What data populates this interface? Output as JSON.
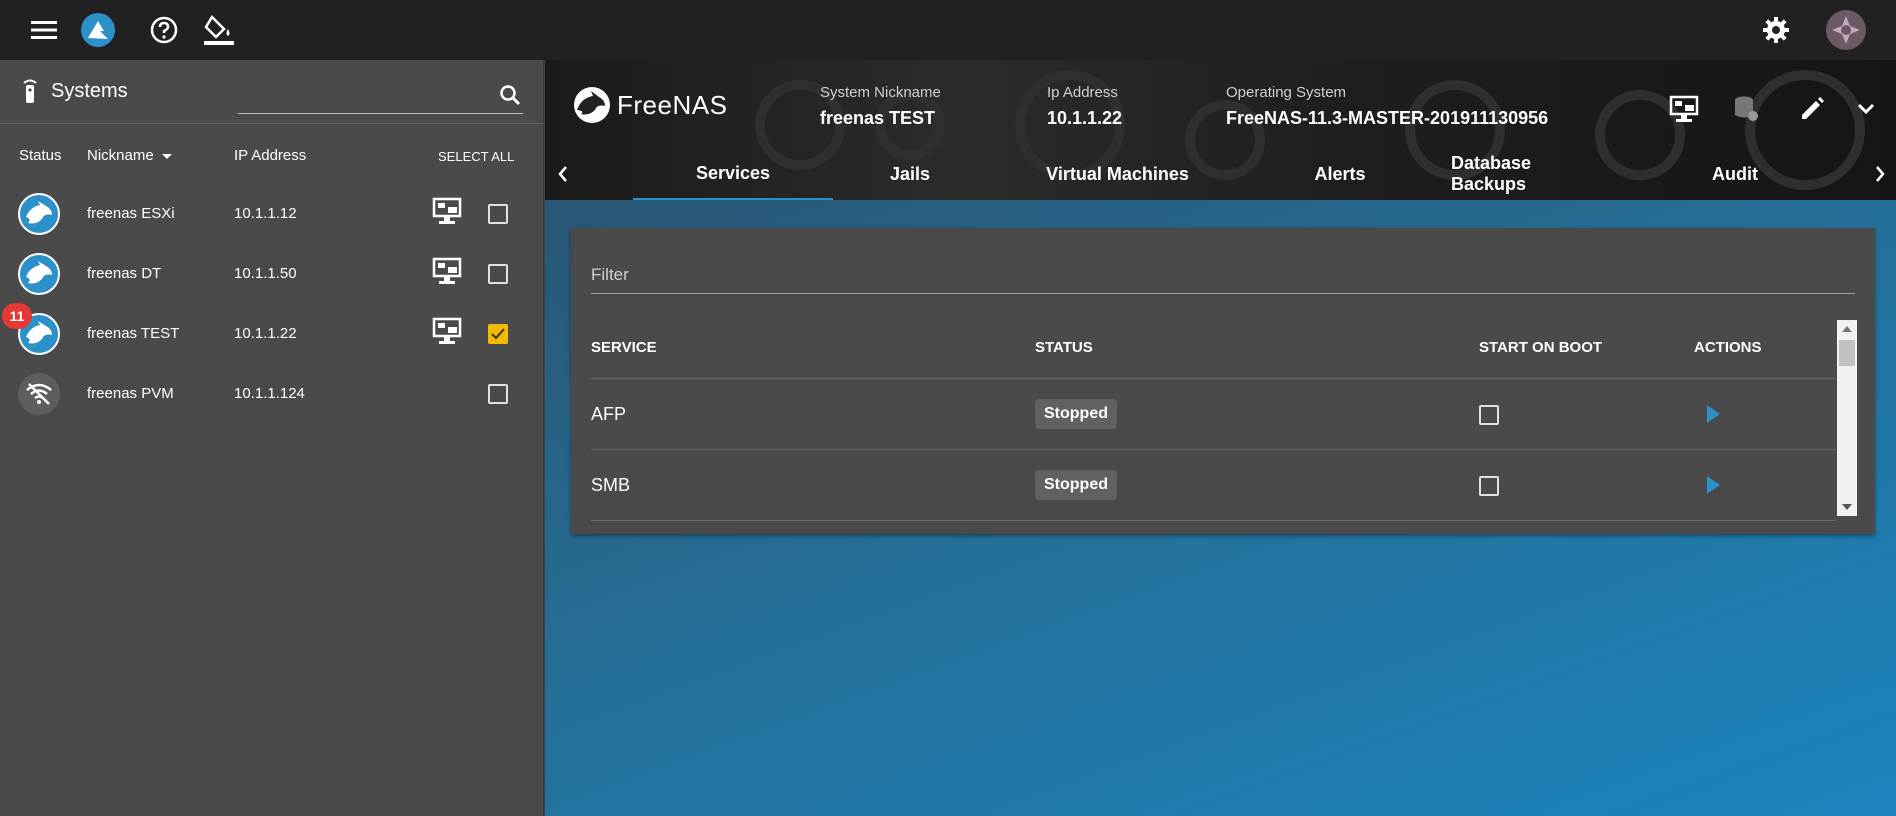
{
  "topbar": {
    "icons": [
      "menu-icon",
      "truecommand-logo-icon",
      "help-icon",
      "theme-paint-icon",
      "settings-icon",
      "user-avatar"
    ]
  },
  "sidebar": {
    "title": "Systems",
    "search": {
      "value": "",
      "placeholder": ""
    },
    "columns": {
      "status": "Status",
      "nickname": "Nickname",
      "ip": "IP Address",
      "select_all": "SELECT ALL"
    },
    "systems": [
      {
        "nickname": "freenas ESXi",
        "ip": "10.1.1.12",
        "status": "online",
        "badge": "",
        "checked": false
      },
      {
        "nickname": "freenas DT",
        "ip": "10.1.1.50",
        "status": "online",
        "badge": "",
        "checked": false
      },
      {
        "nickname": "freenas TEST",
        "ip": "10.1.1.22",
        "status": "online",
        "badge": "11",
        "checked": true
      },
      {
        "nickname": "freenas PVM",
        "ip": "10.1.1.124",
        "status": "offline",
        "badge": "",
        "checked": false
      }
    ]
  },
  "system_header": {
    "logo_text": "FreeNAS",
    "nickname_label": "System Nickname",
    "nickname": "freenas TEST",
    "ip_label": "Ip Address",
    "ip": "10.1.1.22",
    "os_label": "Operating System",
    "os": "FreeNAS-11.3-MASTER-201911130956"
  },
  "tabs": [
    "Services",
    "Jails",
    "Virtual Machines",
    "Alerts",
    "Database Backups",
    "Audit"
  ],
  "active_tab": "Services",
  "services": {
    "filter_placeholder": "Filter",
    "columns": {
      "service": "SERVICE",
      "status": "STATUS",
      "start_on_boot": "START ON BOOT",
      "actions": "ACTIONS"
    },
    "rows": [
      {
        "name": "AFP",
        "status": "Stopped",
        "start_on_boot": false
      },
      {
        "name": "SMB",
        "status": "Stopped",
        "start_on_boot": false
      }
    ]
  },
  "colors": {
    "accent": "#2c90c9",
    "checked": "#f5b800",
    "badge": "#e53935",
    "topbar": "#212121",
    "sidebar": "#4a4a4a"
  }
}
